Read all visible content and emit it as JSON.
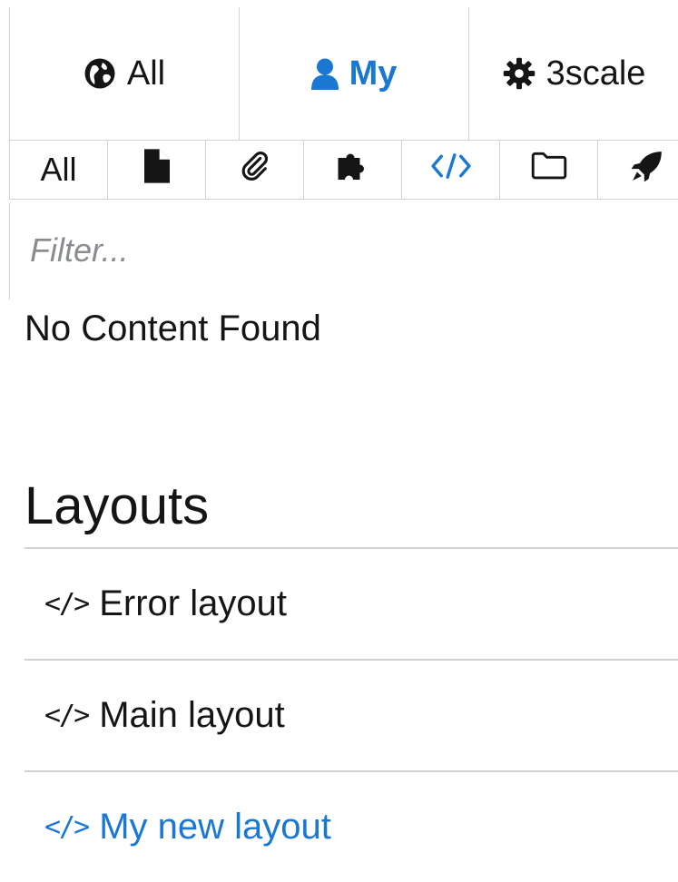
{
  "scope_tabs": [
    {
      "label": "All",
      "icon": "globe-icon"
    },
    {
      "label": "My",
      "icon": "user-icon"
    },
    {
      "label": "3scale",
      "icon": "gear-icon"
    }
  ],
  "type_tabs": {
    "all_label": "All",
    "icons": [
      "file-icon",
      "paperclip-icon",
      "puzzle-icon",
      "code-icon",
      "folder-icon",
      "rocket-icon"
    ]
  },
  "filter": {
    "placeholder": "Filter..."
  },
  "empty_message": "No Content Found",
  "layouts": {
    "title": "Layouts",
    "code_glyph": "</>",
    "items": [
      {
        "label": "Error layout"
      },
      {
        "label": "Main layout"
      },
      {
        "label": "My new layout"
      }
    ]
  },
  "colors": {
    "accent": "#1a78d4",
    "text": "#151515",
    "border": "#d2d2d2",
    "placeholder": "#8a8d90"
  }
}
